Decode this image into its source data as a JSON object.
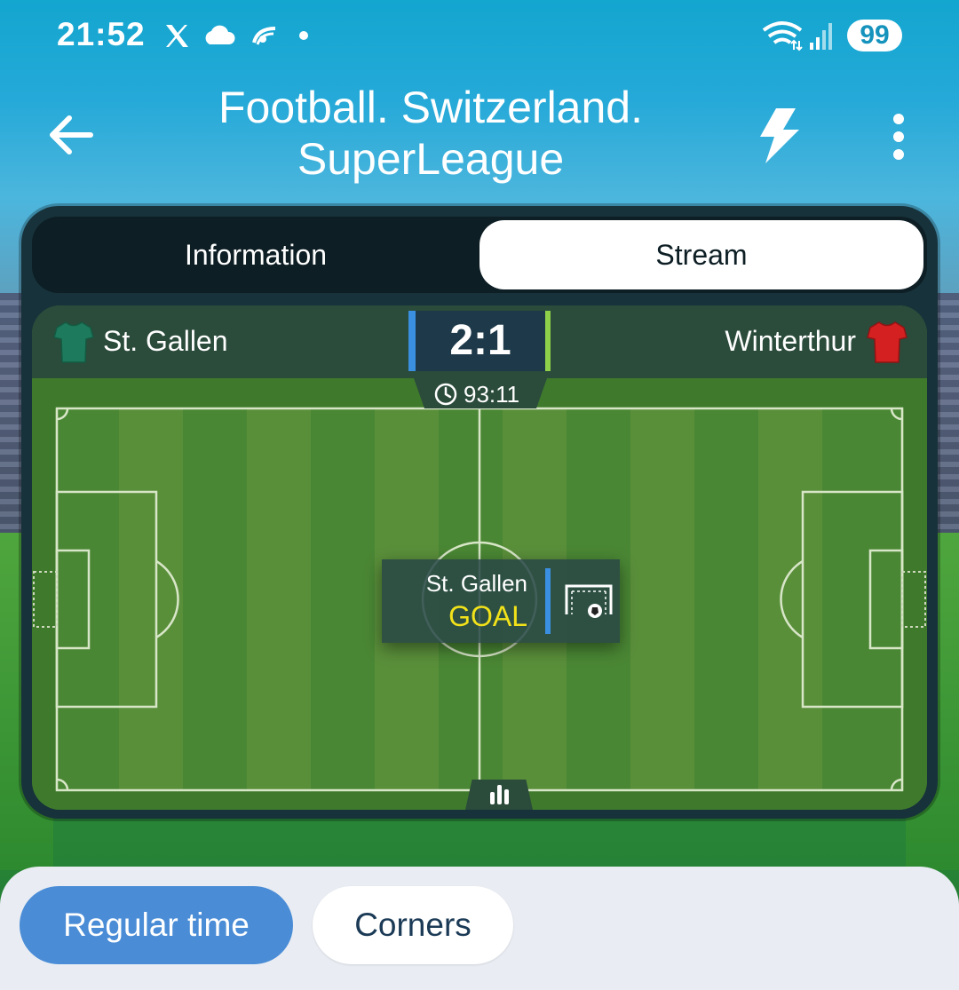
{
  "status_bar": {
    "time": "21:52",
    "battery": "99",
    "icons": [
      "x-icon",
      "cloud-icon",
      "app-icon",
      "dot-icon",
      "wifi-icon",
      "signal-icon"
    ]
  },
  "header": {
    "title_line1": "Football. Switzerland.",
    "title_line2": "SuperLeague",
    "icons": [
      "back-arrow-icon",
      "lightning-icon",
      "more-vertical-icon"
    ]
  },
  "tabs": {
    "information": "Information",
    "stream": "Stream",
    "active": "Stream"
  },
  "match": {
    "home_team": "St. Gallen",
    "away_team": "Winterthur",
    "score": "2:1",
    "time": "93:11",
    "home_color": "#1e7a5c",
    "away_color": "#d42020"
  },
  "event": {
    "team": "St. Gallen",
    "type": "GOAL",
    "icon": "goal-net-icon"
  },
  "bottom_tabs": {
    "regular": "Regular time",
    "corners": "Corners",
    "active": "Regular time"
  },
  "colors": {
    "accent": "#4a8cd6",
    "goal_text": "#f2e21a",
    "card_bg": "#17323b"
  }
}
